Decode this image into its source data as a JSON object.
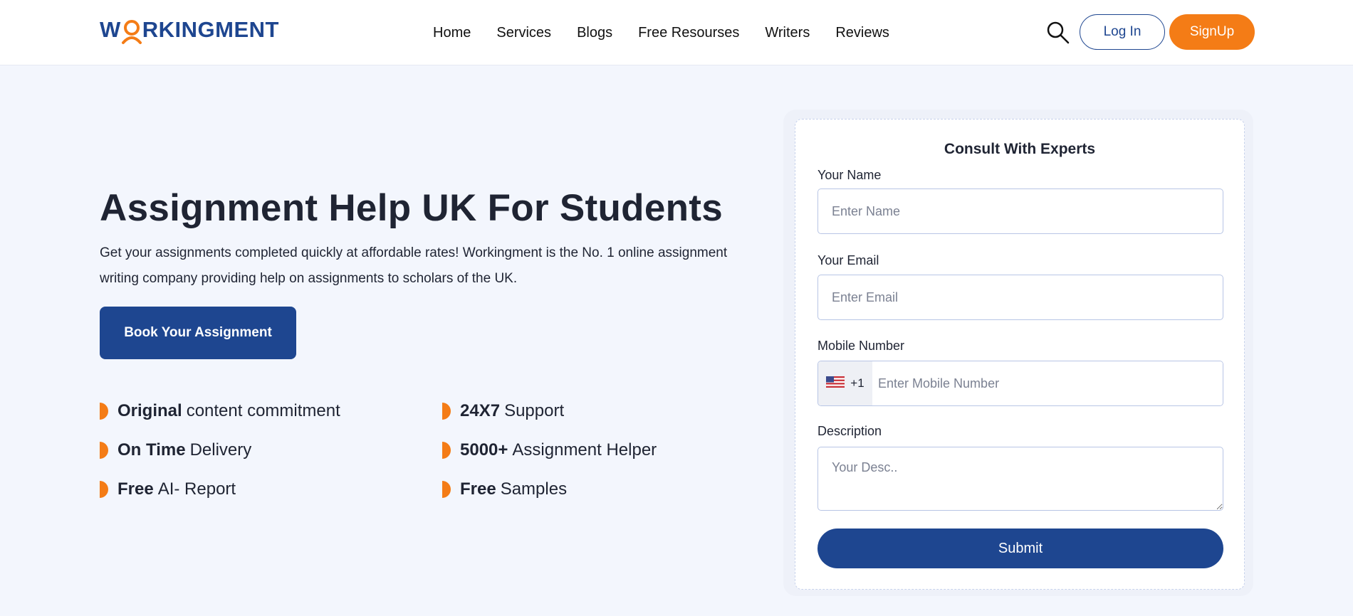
{
  "header": {
    "logo": {
      "part1": "W",
      "part2": "RKINGMENT",
      "brand_color": "#1e4690",
      "accent_color": "#f47c16"
    },
    "nav": [
      "Home",
      "Services",
      "Blogs",
      "Free Resourses",
      "Writers",
      "Reviews"
    ],
    "search_icon": "search-icon",
    "login_label": "Log In",
    "signup_label": "SignUp"
  },
  "hero": {
    "title": "Assignment Help UK For Students",
    "description": "Get your assignments completed quickly at affordable rates! Workingment is the No. 1 online assignment writing company providing help on assignments to scholars of the UK.",
    "book_button": "Book Your Assignment",
    "features": [
      {
        "bold": "Original",
        "text": "content commitment"
      },
      {
        "bold": "24X7",
        "text": "Support"
      },
      {
        "bold": "On Time",
        "text": "Delivery"
      },
      {
        "bold": "5000+",
        "text": "Assignment Helper"
      },
      {
        "bold": "Free",
        "text": "AI- Report"
      },
      {
        "bold": "Free",
        "text": "Samples"
      }
    ]
  },
  "form": {
    "title": "Consult With Experts",
    "name_label": "Your Name",
    "name_placeholder": "Enter Name",
    "email_label": "Your Email",
    "email_placeholder": "Enter Email",
    "mobile_label": "Mobile Number",
    "country_code": "+1",
    "country_flag_icon": "us-flag-icon",
    "mobile_placeholder": "Enter Mobile Number",
    "description_label": "Description",
    "description_placeholder": "Your Desc..",
    "submit_label": "Submit"
  },
  "colors": {
    "primary": "#1e4690",
    "accent": "#f47c16",
    "background": "#f3f6fd"
  }
}
